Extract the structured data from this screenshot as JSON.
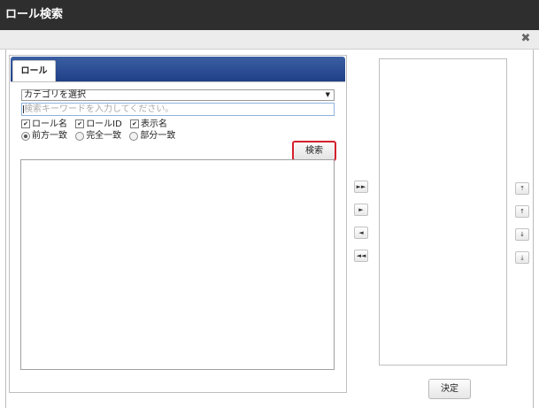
{
  "window": {
    "title": "ロール検索"
  },
  "icons": {
    "close": "close-icon"
  },
  "tab": {
    "label": "ロール"
  },
  "category_select": {
    "selected": "カテゴリを選択",
    "arrow": "▼"
  },
  "keyword_input": {
    "placeholder": "検索キーワードを入力してください。",
    "value": ""
  },
  "fields": [
    {
      "label": "ロール名",
      "checked": true
    },
    {
      "label": "ロールID",
      "checked": true
    },
    {
      "label": "表示名",
      "checked": true
    }
  ],
  "match_modes": [
    {
      "label": "前方一致",
      "selected": true
    },
    {
      "label": "完全一致",
      "selected": false
    },
    {
      "label": "部分一致",
      "selected": false
    }
  ],
  "search_button": {
    "label": "検索"
  },
  "transfer_buttons": [
    {
      "name": "add-all-button",
      "glyph": "►►"
    },
    {
      "name": "add-button",
      "glyph": "►"
    },
    {
      "name": "remove-button",
      "glyph": "◄"
    },
    {
      "name": "remove-all-button",
      "glyph": "◄◄"
    }
  ],
  "order_buttons": [
    {
      "name": "move-top-button",
      "glyph": "⤒"
    },
    {
      "name": "move-up-button",
      "glyph": "↑"
    },
    {
      "name": "move-down-button",
      "glyph": "↓"
    },
    {
      "name": "move-bottom-button",
      "glyph": "⤓"
    }
  ],
  "decide_button": {
    "label": "決定"
  },
  "check_glyph": "✔"
}
